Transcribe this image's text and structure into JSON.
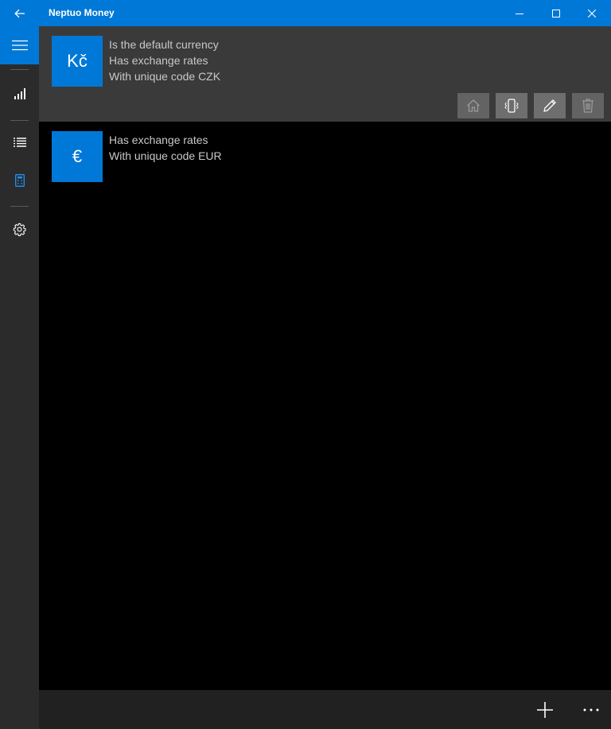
{
  "window": {
    "title": "Neptuo Money"
  },
  "currencies": [
    {
      "symbol": "Kč",
      "lines": [
        "Is the default currency",
        "Has exchange rates",
        "With unique code CZK"
      ],
      "selected": true
    },
    {
      "symbol": "€",
      "lines": [
        "Has exchange rates",
        "With unique code EUR"
      ],
      "selected": false
    }
  ],
  "icons": {
    "back": "back-arrow-icon",
    "minimize": "minimize-icon",
    "maximize": "maximize-icon",
    "close": "close-icon",
    "hamburger": "hamburger-menu-icon",
    "summary": "signal-bars-icon",
    "list": "list-icon",
    "currencies": "calculator-icon",
    "settings": "gear-icon",
    "set_default": "home-icon",
    "exchange_rates": "phone-vibrate-icon",
    "edit": "pencil-icon",
    "delete": "trash-icon",
    "add": "plus-icon",
    "more": "more-ellipsis-icon"
  },
  "colors": {
    "accent": "#0078d7",
    "sidebar": "#2b2b2b",
    "selected_row": "#3a3a3a"
  }
}
